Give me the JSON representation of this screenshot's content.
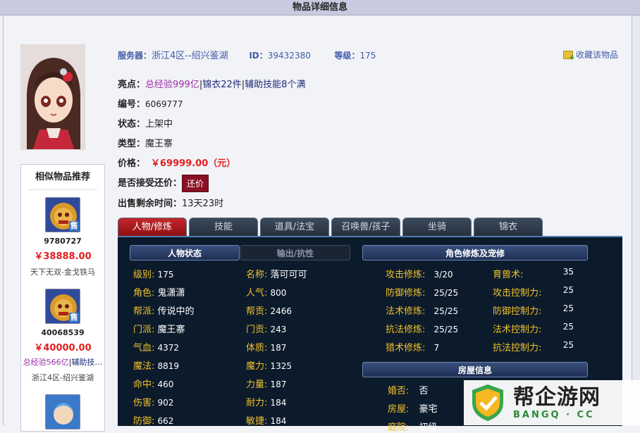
{
  "page_title": "物品详细信息",
  "server": {
    "label": "服务器：",
    "value": "浙江4区--绍兴鉴湖"
  },
  "id": {
    "label": "ID：",
    "value": "39432380"
  },
  "level": {
    "label": "等级：",
    "value": "175"
  },
  "favorite": {
    "label": "收藏该物品"
  },
  "highlights": {
    "label": "亮点：",
    "part1": "总经验999亿",
    "sep1": "|",
    "part2": "锦衣22件",
    "sep2": "|",
    "part3": "辅助技能8个满"
  },
  "serial": {
    "label": "编号：",
    "value": "6069777"
  },
  "status": {
    "label": "状态：",
    "value": "上架中"
  },
  "type": {
    "label": "类型：",
    "value": "魔王寨"
  },
  "price": {
    "label": "价格：",
    "value": "￥69999.00（元）"
  },
  "bargain": {
    "label": "是否接受还价：",
    "button": "还价"
  },
  "remaining": {
    "label": "出售剩余时间：",
    "value": "13天23时"
  },
  "tabs": [
    "人物/修炼",
    "技能",
    "道具/法宝",
    "召唤兽/孩子",
    "坐骑",
    "锦衣"
  ],
  "similar": {
    "title": "相似物品推荐",
    "items": [
      {
        "id": "9780727",
        "price": "￥38888.00",
        "desc": "天下无双-金戈铁马",
        "badge": "售"
      },
      {
        "id": "40068539",
        "price": "￥40000.00",
        "highlight_a": "总经验566亿",
        "highlight_sep": "|",
        "highlight_b": "辅助技…",
        "desc": "浙江4区-绍兴鉴湖",
        "badge": "售"
      }
    ]
  },
  "character": {
    "tab_active": "人物状态",
    "tab_inactive": "输出/抗性",
    "stats_left": [
      {
        "k": "级别:",
        "v": "175"
      },
      {
        "k": "角色:",
        "v": "鬼潇潇"
      },
      {
        "k": "帮派:",
        "v": "传说中的"
      },
      {
        "k": "门派:",
        "v": "魔王寨"
      },
      {
        "k": "气血:",
        "v": "4372"
      },
      {
        "k": "魔法:",
        "v": "8819"
      },
      {
        "k": "命中:",
        "v": "460"
      },
      {
        "k": "伤害:",
        "v": "902"
      },
      {
        "k": "防御:",
        "v": "662"
      }
    ],
    "stats_right": [
      {
        "k": "名称:",
        "v": "落可可可"
      },
      {
        "k": "人气:",
        "v": "800"
      },
      {
        "k": "帮贡:",
        "v": "2466"
      },
      {
        "k": "门贡:",
        "v": "243"
      },
      {
        "k": "体质:",
        "v": "187"
      },
      {
        "k": "魔力:",
        "v": "1325"
      },
      {
        "k": "力量:",
        "v": "187"
      },
      {
        "k": "耐力:",
        "v": "184"
      },
      {
        "k": "敏捷:",
        "v": "184"
      }
    ]
  },
  "cultivation": {
    "title": "角色修炼及宠修",
    "left": [
      {
        "k": "攻击修炼:",
        "v": "3/20"
      },
      {
        "k": "防御修炼:",
        "v": "25/25"
      },
      {
        "k": "法术修炼:",
        "v": "25/25"
      },
      {
        "k": "抗法修炼:",
        "v": "25/25"
      },
      {
        "k": "猎术修炼:",
        "v": "7"
      }
    ],
    "right": [
      {
        "k": "育兽术:",
        "v": "35"
      },
      {
        "k": "攻击控制力:",
        "v": "25"
      },
      {
        "k": "防御控制力:",
        "v": "25"
      },
      {
        "k": "法术控制力:",
        "v": "25"
      },
      {
        "k": "抗法控制力:",
        "v": "25"
      }
    ]
  },
  "house": {
    "title": "房屋信息",
    "rows": [
      {
        "k": "婚否:",
        "v": "否"
      },
      {
        "k": "房屋:",
        "v": "豪宅"
      },
      {
        "k": "庭院:",
        "v": "初级"
      }
    ]
  },
  "watermark": {
    "main": "帮企游网",
    "sub": "BANGQ · CC"
  }
}
